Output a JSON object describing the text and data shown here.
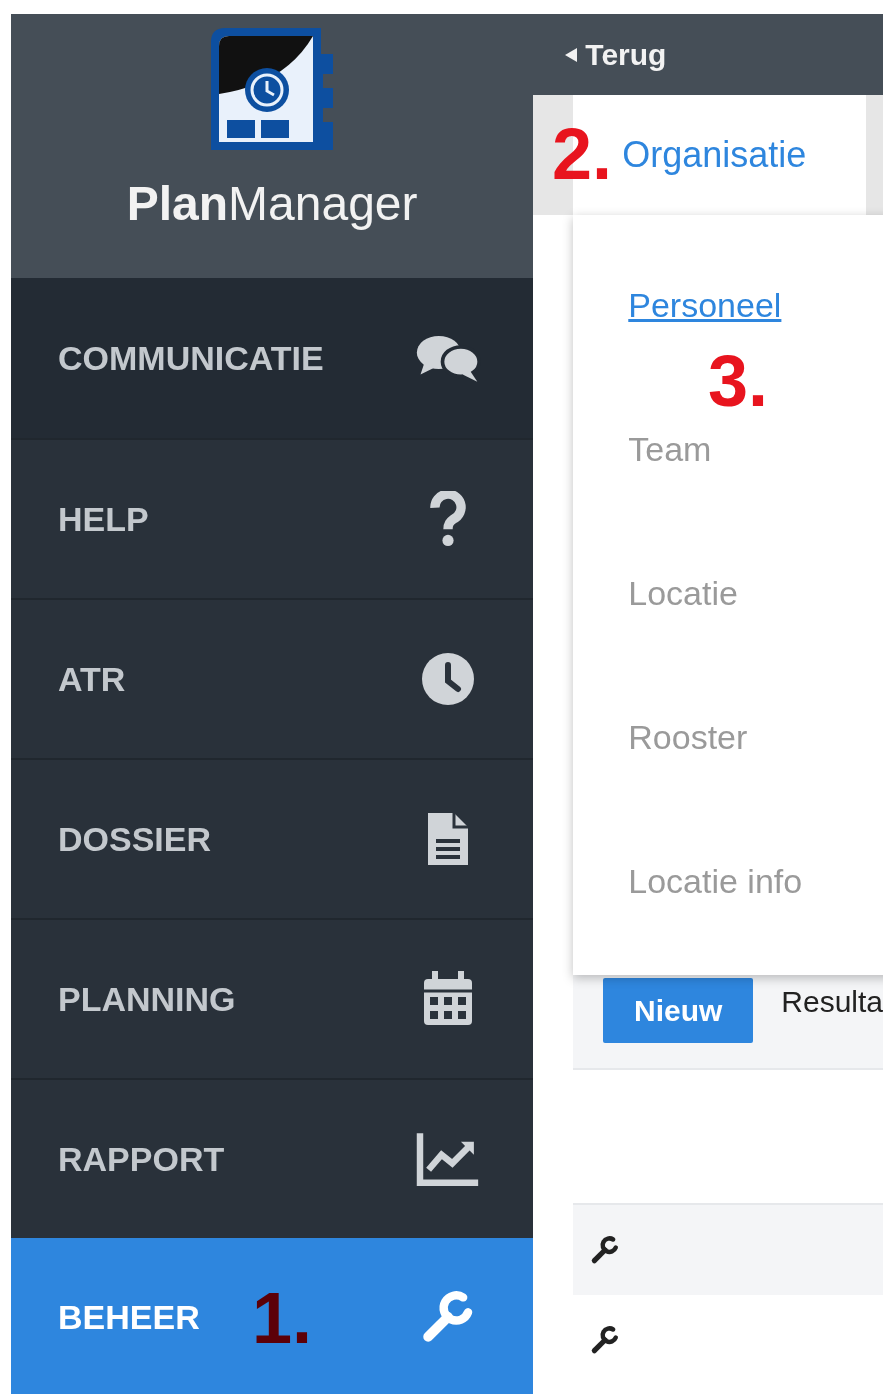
{
  "logo": {
    "title": "**Plan**Manager"
  },
  "menu": [
    {
      "label": "COMMUNICATIE",
      "kind": "chat",
      "selected": false
    },
    {
      "label": "HELP",
      "kind": "help",
      "selected": false
    },
    {
      "label": "ATR",
      "kind": "clock",
      "selected": false
    },
    {
      "label": "DOSSIER",
      "kind": "document",
      "selected": false
    },
    {
      "label": "PLANNING",
      "kind": "calendar",
      "selected": false
    },
    {
      "label": "RAPPORT",
      "kind": "chart",
      "selected": false
    },
    {
      "label": "BEHEER",
      "kind": "wrench",
      "selected": true
    }
  ],
  "back": {
    "label": "Terug"
  },
  "tabs": [
    {
      "label": "Organisatie",
      "selected": true
    }
  ],
  "dropdown": [
    {
      "label": "Personeel",
      "selected": true
    },
    {
      "label": "Team",
      "selected": false
    },
    {
      "label": "Locatie",
      "selected": false
    },
    {
      "label": "Rooster",
      "selected": false
    },
    {
      "label": "Locatie info",
      "selected": false
    }
  ],
  "toolbar": {
    "button": "Nieuw",
    "result_text": "Resulta"
  },
  "rows": [
    {
      "kind": "tool"
    },
    {
      "kind": "tool"
    }
  ],
  "annotations": [
    {
      "label": "1."
    },
    {
      "label": "2."
    },
    {
      "label": "3."
    }
  ]
}
